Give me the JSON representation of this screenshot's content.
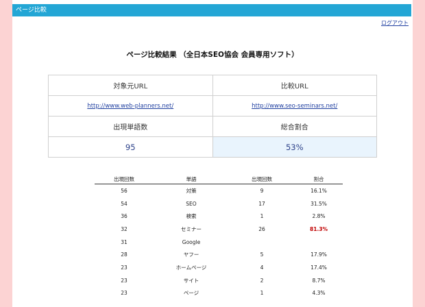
{
  "header": {
    "title": "ページ比較",
    "logout_label": "ログアウト"
  },
  "result_title": "ページ比較結果 （全日本SEO協会 会員専用ソフト）",
  "comparison": {
    "source_label": "対象元URL",
    "compare_label": "比較URL",
    "source_url": "http://www.web-planners.net/",
    "compare_url": "http://www.seo-seminars.net/",
    "word_count_label": "出現単語数",
    "total_ratio_label": "総合割合",
    "word_count_value": "95",
    "total_ratio_value": "53%"
  },
  "word_table": {
    "headers": [
      "出現回数",
      "単語",
      "出現回数",
      "割合"
    ],
    "rows": [
      {
        "count1": "56",
        "word": "対策",
        "count2": "9",
        "ratio": "16.1%",
        "highlight": false
      },
      {
        "count1": "54",
        "word": "SEO",
        "count2": "17",
        "ratio": "31.5%",
        "highlight": false
      },
      {
        "count1": "36",
        "word": "検索",
        "count2": "1",
        "ratio": "2.8%",
        "highlight": false
      },
      {
        "count1": "32",
        "word": "セミナー",
        "count2": "26",
        "ratio": "81.3%",
        "highlight": true
      },
      {
        "count1": "31",
        "word": "Google",
        "count2": "",
        "ratio": "",
        "highlight": false
      },
      {
        "count1": "28",
        "word": "ヤフー",
        "count2": "5",
        "ratio": "17.9%",
        "highlight": false
      },
      {
        "count1": "23",
        "word": "ホームページ",
        "count2": "4",
        "ratio": "17.4%",
        "highlight": false
      },
      {
        "count1": "23",
        "word": "サイト",
        "count2": "2",
        "ratio": "8.7%",
        "highlight": false
      },
      {
        "count1": "23",
        "word": "ページ",
        "count2": "1",
        "ratio": "4.3%",
        "highlight": false
      }
    ]
  },
  "colors": {
    "header_bar": "#23a6d5",
    "background": "#fcd3d3",
    "highlight_ratio": "#c00000",
    "link": "#1f3fa0"
  }
}
